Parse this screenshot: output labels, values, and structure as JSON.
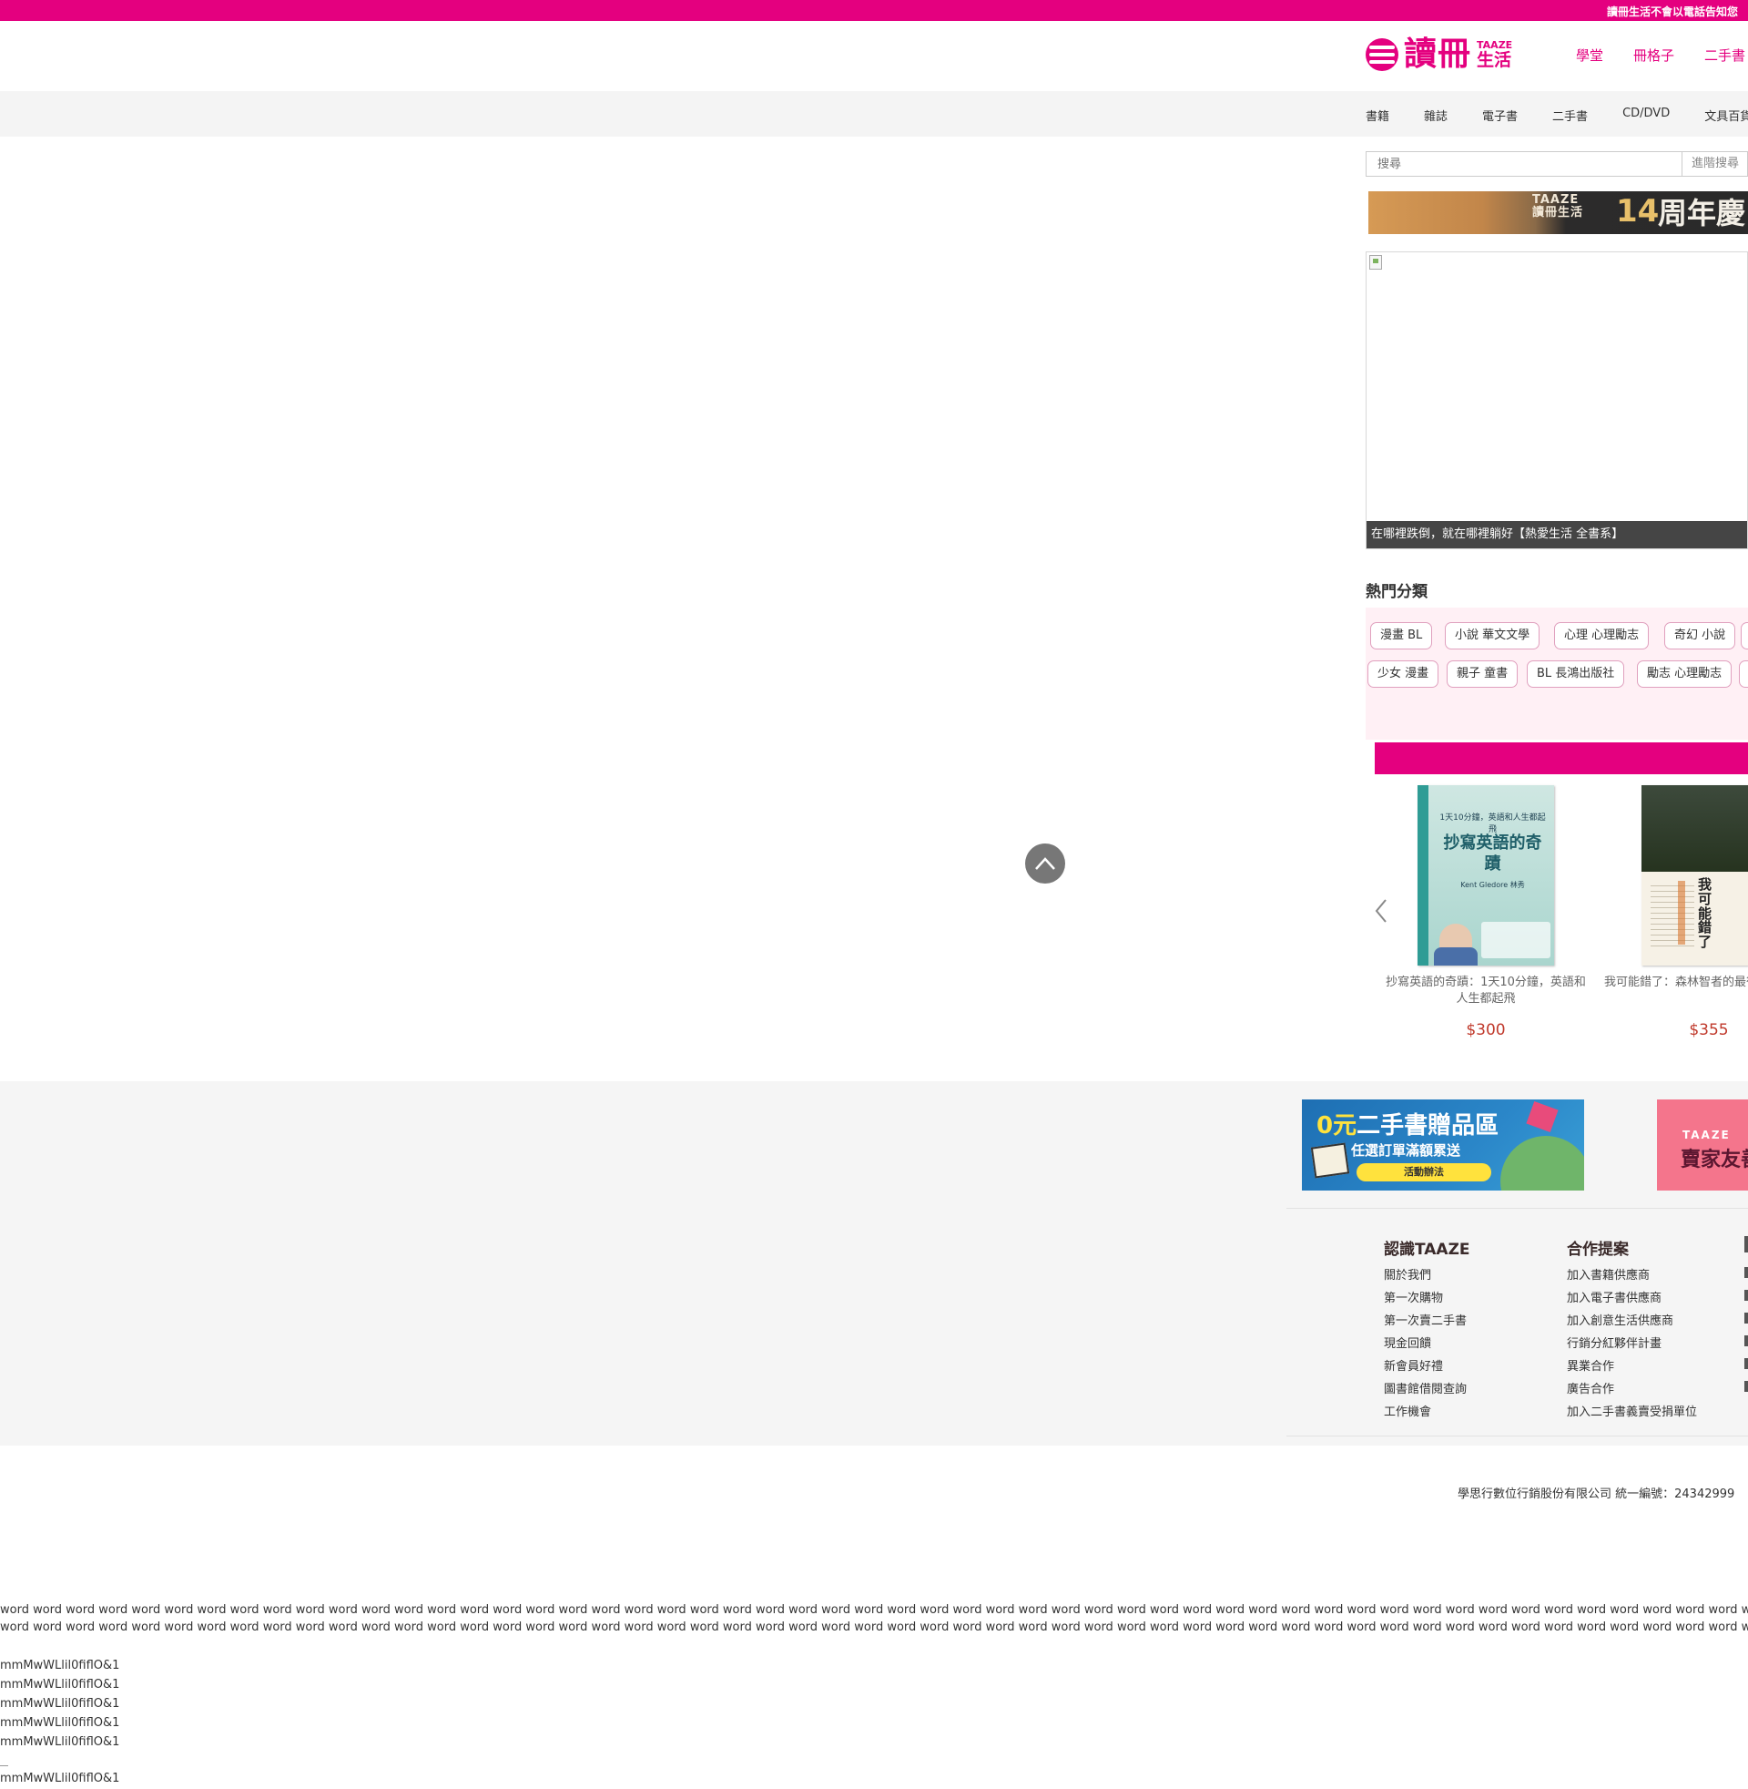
{
  "notice": {
    "text": "讀冊生活不會以電話告知您"
  },
  "logo": {
    "main": "讀冊",
    "en": "TAAZE",
    "zh": "生活"
  },
  "top_nav": [
    "學堂",
    "冊格子",
    "二手書"
  ],
  "category_nav": [
    "書籍",
    "雜誌",
    "電子書",
    "二手書",
    "CD/DVD",
    "文具百貨"
  ],
  "search": {
    "placeholder": "搜尋",
    "advanced": "進階搜尋"
  },
  "anniversary_banner": {
    "brand_en": "TAAZE",
    "brand_zh": "讀冊生活",
    "number": "14",
    "text": "周年慶"
  },
  "slide": {
    "caption": "在哪裡跌倒，就在哪裡躺好【熱愛生活 全書系】"
  },
  "hot_categories": {
    "title": "熱門分類",
    "row1": [
      "漫畫 BL",
      "小說 華文文學",
      "心理 心理勵志",
      "奇幻 小說"
    ],
    "row2": [
      "少女 漫畫",
      "親子 童書",
      "BL 長鴻出版社",
      "勵志 心理勵志"
    ]
  },
  "products": [
    {
      "title": "抄寫英語的奇蹟：1天10分鐘，英語和人生都起飛",
      "price": "$300",
      "cover": {
        "kicker": "1天10分鐘，英語和人生都起飛",
        "title": "抄寫英語的奇蹟",
        "author": "Kent Gledore 林秀"
      }
    },
    {
      "title": "我可能錯了：森林智者的最後一堂人生課",
      "price": "$355",
      "cover": {
        "title": "我可能錯了"
      }
    }
  ],
  "footer": {
    "used_banner": {
      "headline_accent": "0元",
      "headline": "二手書贈品區",
      "sub": "任選訂單滿額累送",
      "button": "活動辦法"
    },
    "seller_banner": {
      "en": "TAAZE",
      "zh": "賣家友善"
    },
    "columns": [
      {
        "title": "認識TAAZE",
        "items": [
          "關於我們",
          "第一次購物",
          "第一次賣二手書",
          "現金回饋",
          "新會員好禮",
          "圖書館借閱查詢",
          "工作機會"
        ]
      },
      {
        "title": "合作提案",
        "items": [
          "加入書籍供應商",
          "加入電子書供應商",
          "加入創意生活供應商",
          "行銷分紅夥伴計畫",
          "異業合作",
          "廣告合作",
          "加入二手書義賣受捐單位"
        ]
      }
    ],
    "copyright": "學思行數位行銷股份有限公司 統一編號：24342999"
  },
  "test_text": {
    "word_line": "word word word word word word word word word word word word word word word word word word word word word word word word word word word word word word word word word word word word word word word word word word word word word word word word word word word word word word word word word word word word word word word word word word word word word word word word word word word word word word word",
    "glyph_line": "mmMwWLlil0fiflO&1"
  },
  "colors": {
    "brand": "#e4007f",
    "price": "#c0392b",
    "hot_panel_bg": "#fff0f5"
  }
}
